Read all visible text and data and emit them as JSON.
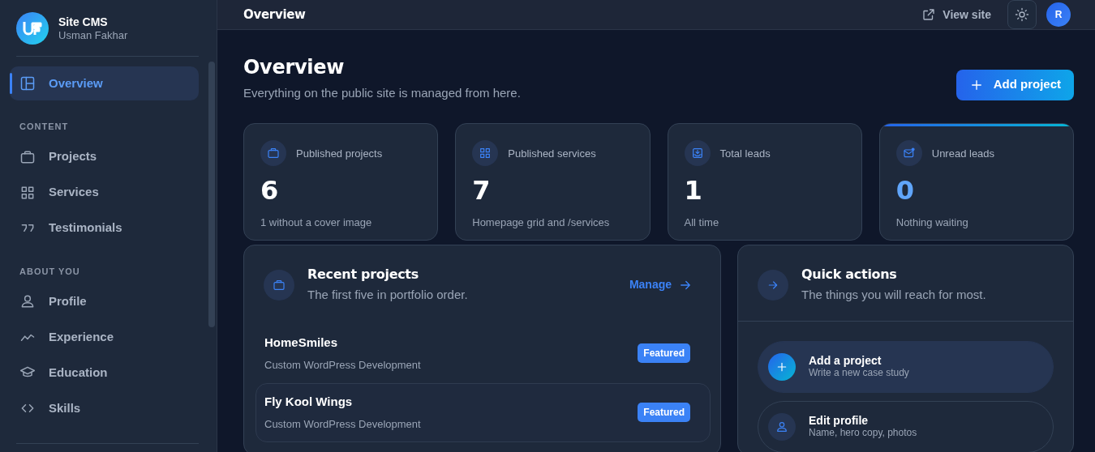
{
  "brand": {
    "title": "Site CMS",
    "subtitle": "Usman Fakhar"
  },
  "sidebar": {
    "items": [
      {
        "label": "Overview",
        "selected": true
      }
    ],
    "sections": [
      {
        "heading": "CONTENT",
        "items": [
          {
            "label": "Projects",
            "selected": false
          },
          {
            "label": "Services",
            "selected": false
          },
          {
            "label": "Testimonials",
            "selected": false
          }
        ]
      },
      {
        "heading": "ABOUT YOU",
        "items": [
          {
            "label": "Profile",
            "selected": false
          },
          {
            "label": "Experience",
            "selected": false
          },
          {
            "label": "Education",
            "selected": false
          },
          {
            "label": "Skills",
            "selected": false
          }
        ]
      }
    ]
  },
  "topbar": {
    "title": "Overview",
    "view_site": "View site",
    "avatar": "R"
  },
  "header": {
    "title": "Overview",
    "subtitle": "Everything on the public site is managed from here.",
    "button": "Add project"
  },
  "stats": [
    {
      "label": "Published projects",
      "value": "6",
      "note": "1 without a cover image",
      "accent": false
    },
    {
      "label": "Published services",
      "value": "7",
      "note": "Homepage grid and /services",
      "accent": false
    },
    {
      "label": "Total leads",
      "value": "1",
      "note": "All time",
      "accent": false
    },
    {
      "label": "Unread leads",
      "value": "0",
      "note": "Nothing waiting",
      "accent": true
    }
  ],
  "recent_projects": {
    "title": "Recent projects",
    "subtitle": "The first five in portfolio order.",
    "link": "Manage",
    "rows": [
      {
        "name": "HomeSmiles",
        "category": "Custom WordPress Development",
        "badge": "Featured",
        "hovered": false
      },
      {
        "name": "Fly Kool Wings",
        "category": "Custom WordPress Development",
        "badge": "Featured",
        "hovered": true
      }
    ]
  },
  "quick_actions": {
    "title": "Quick actions",
    "subtitle": "The things you will reach for most.",
    "items": [
      {
        "title": "Add a project",
        "subtitle": "Write a new case study",
        "primary": true
      },
      {
        "title": "Edit profile",
        "subtitle": "Name, hero copy, photos",
        "primary": false
      }
    ]
  }
}
